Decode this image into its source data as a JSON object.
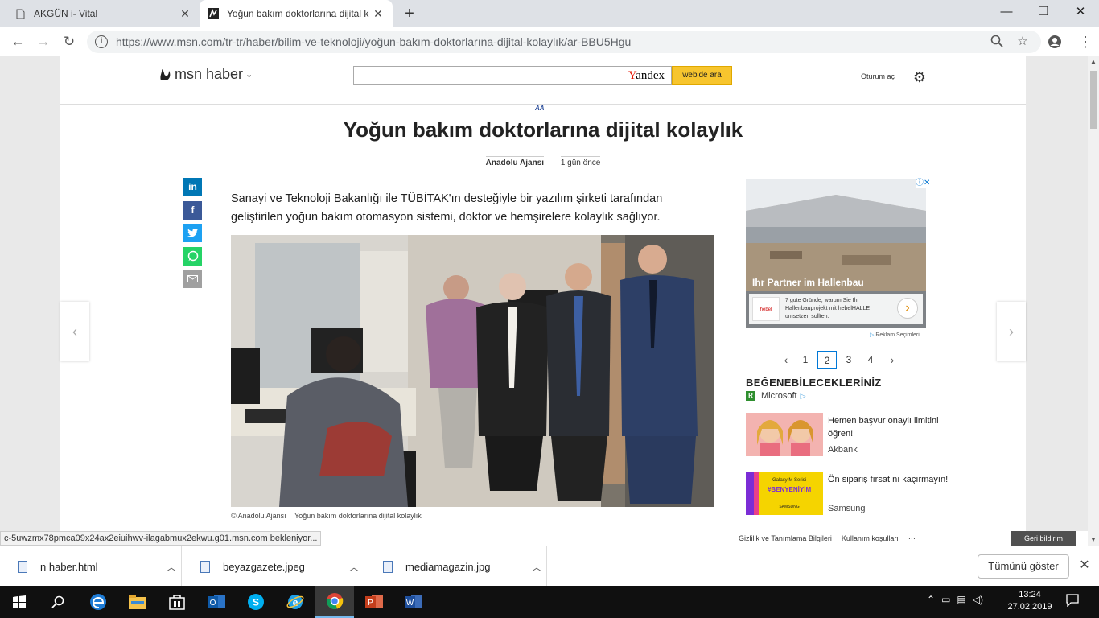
{
  "browser": {
    "tabs": [
      {
        "title": "AKGÜN i- Vital",
        "active": false
      },
      {
        "title": "Yoğun bakım doktorlarına dijital k",
        "active": true
      }
    ],
    "url": "https://www.msn.com/tr-tr/haber/bilim-ve-teknoloji/yoğun-bakım-doktorlarına-dijital-kolaylık/ar-BBU5Hgu",
    "status_text": "c-5uwzmx78pmca09x24ax2eiuihwv-ilagabmux2ekwu.g01.msn.com bekleniyor..."
  },
  "msn": {
    "brand": "msn haber",
    "search_engine": "Yandex",
    "search_button": "web'de ara",
    "signin": "Oturum aç",
    "source_logo": "AA"
  },
  "article": {
    "title": "Yoğun bakım doktorlarına dijital kolaylık",
    "source": "Anadolu Ajansı",
    "time": "1 gün önce",
    "lead": "Sanayi ve Teknoloji Bakanlığı ile TÜBİTAK'ın desteğiyle bir yazılım şirketi tarafından geliştirilen yoğun bakım otomasyon sistemi, doktor ve hemşirelere kolaylık sağlıyor.",
    "photo_caption_source": "© Anadolu Ajansı",
    "photo_caption": "Yoğun bakım doktorlarına dijital kolaylık"
  },
  "social": [
    "in",
    "f",
    "t",
    "w",
    "✉"
  ],
  "ad": {
    "title": "Ihr Partner im Hallenbau",
    "brand": "hebel HALLE",
    "text": "7 gute Gründe, warum Sie Ihr Hallenbauprojekt mit hebelHALLE umsetzen sollten.",
    "adchoices": "Reklam Seçimleri"
  },
  "pager": {
    "pages": [
      "1",
      "2",
      "3",
      "4"
    ],
    "current": "2"
  },
  "recommend": {
    "title": "BEĞENEBİLECEKLERİNİZ",
    "source": "Microsoft",
    "items": [
      {
        "title": "Hemen başvur onaylı limitini öğren!",
        "source": "Akbank"
      },
      {
        "title": "Ön sipariş fırsatını kaçırmayın!",
        "source": "Samsung"
      }
    ],
    "samsung_thumb": {
      "line1": "Galaxy M Serisi",
      "line2": "#BENYENİYİM",
      "line3": "SAMSUNG"
    }
  },
  "footer": {
    "links": [
      "Gizlilik ve Tanımlama Bilgileri",
      "Kullanım koşulları",
      "···"
    ],
    "feedback": "Geri bildirim"
  },
  "downloads": {
    "items": [
      {
        "name": "n haber.html"
      },
      {
        "name": "beyazgazete.jpeg"
      },
      {
        "name": "mediamagazin.jpg"
      }
    ],
    "show_all": "Tümünü göster"
  },
  "taskbar": {
    "time": "13:24",
    "date": "27.02.2019",
    "apps": [
      "start",
      "search",
      "edge",
      "file-explorer",
      "store",
      "outlook",
      "skype",
      "internet-explorer",
      "chrome",
      "powerpoint",
      "word"
    ],
    "active_app": "chrome"
  },
  "colors": {
    "accent": "#0078d7",
    "search_button": "#f7c52e",
    "taskbar": "#101010"
  }
}
